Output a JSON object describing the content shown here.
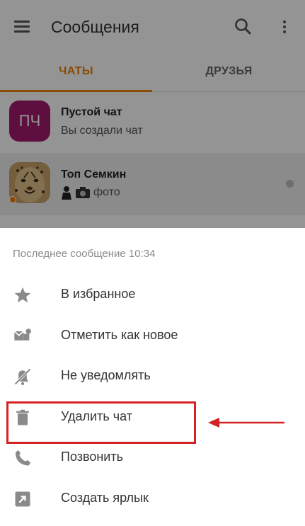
{
  "header": {
    "title": "Сообщения"
  },
  "tabs": [
    {
      "label": "ЧАТЫ",
      "active": true
    },
    {
      "label": "ДРУЗЬЯ",
      "active": false
    }
  ],
  "chats": [
    {
      "name": "Пустой чат",
      "preview": "Вы создали чат",
      "avatar_text": "ПЧ",
      "avatar_color": "#a21a6d"
    },
    {
      "name": "Топ Семкин",
      "preview": "фото",
      "online": true,
      "unread": true
    }
  ],
  "sheet": {
    "caption": "Последнее сообщение 10:34",
    "items": [
      {
        "label": "В избранное",
        "icon": "star-icon"
      },
      {
        "label": "Отметить как новое",
        "icon": "mail-plus-icon"
      },
      {
        "label": "Не уведомлять",
        "icon": "bell-off-icon"
      },
      {
        "label": "Удалить чат",
        "icon": "trash-icon",
        "highlighted": true
      },
      {
        "label": "Позвонить",
        "icon": "phone-icon"
      },
      {
        "label": "Создать ярлык",
        "icon": "shortcut-icon"
      }
    ]
  },
  "colors": {
    "accent": "#ee8208",
    "annotation": "#d42224"
  }
}
